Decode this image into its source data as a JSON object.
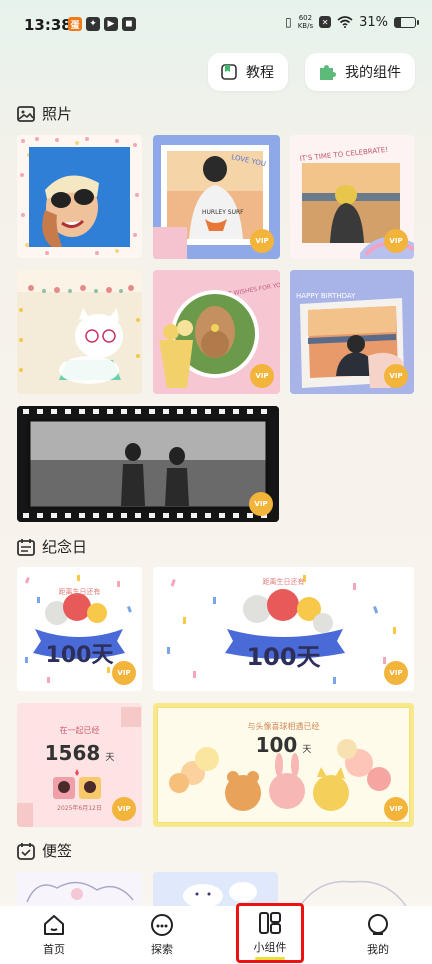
{
  "status": {
    "time": "13:38",
    "net_speed_value": "602",
    "net_speed_unit": "KB/s",
    "battery_text": "31%",
    "battery_level": 0.31
  },
  "header": {
    "tutorial_label": "教程",
    "my_widgets_label": "我的组件"
  },
  "sections": {
    "photos_title": "照片",
    "anniversary_title": "纪念日",
    "notes_title": "便签"
  },
  "photo_tiles": {
    "love_you_text": "LOVE YOU",
    "celebrate_text": "IT'S TIME TO CELEBRATE!",
    "best_wishes_text": "BEST WISHES FOR YOU",
    "birthday_text": "HAPPY BIRTHDAY",
    "shirt_text": "HURLEY SURF"
  },
  "anniversary_tiles": {
    "birthday_countdown_label": "距离生日还有",
    "days_value": "100天",
    "together_label": "在一起已经",
    "together_days": "1568",
    "together_unit": "天",
    "together_date": "2025年6月12日",
    "pets_label": "与头像喜球相遇已经",
    "pets_days": "100",
    "pets_unit": "天"
  },
  "vip_label": "VIP",
  "nav": {
    "home": "首页",
    "explore": "探索",
    "widgets": "小组件",
    "mine": "我的"
  },
  "colors": {
    "vip_badge": "#f2b43b",
    "active_frame": "#e11111",
    "active_underline": "#e9e23c"
  }
}
